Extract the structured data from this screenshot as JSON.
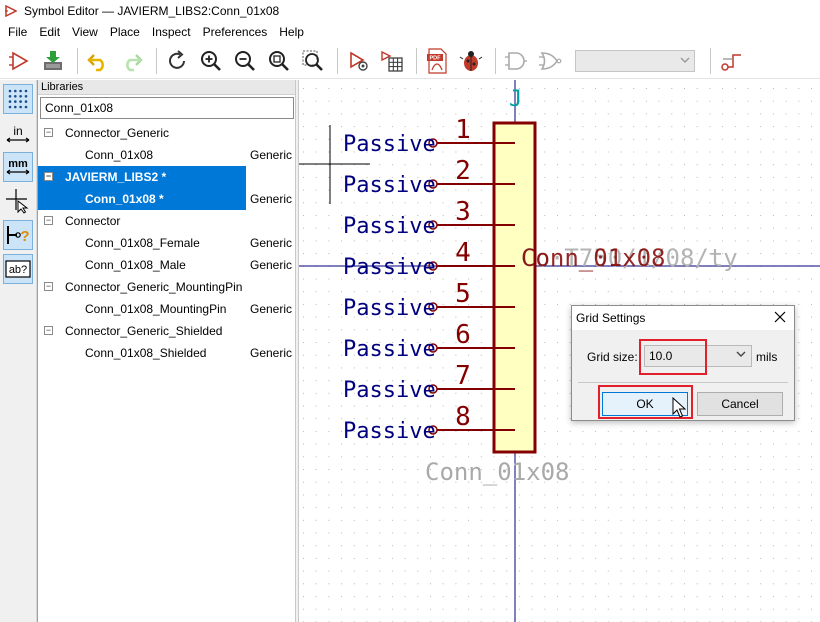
{
  "window": {
    "title": "Symbol Editor — JAVIERM_LIBS2:Conn_01x08"
  },
  "menu": [
    "File",
    "Edit",
    "View",
    "Place",
    "Inspect",
    "Preferences",
    "Help"
  ],
  "toolbar": {
    "icons": [
      "new-symbol-icon",
      "save-icon",
      "undo-icon",
      "redo-icon",
      "refresh-icon",
      "zoom-in-icon",
      "zoom-out-icon",
      "zoom-fit-icon",
      "zoom-selection-icon",
      "symbol-properties-icon",
      "pin-table-icon",
      "export-pdf-icon",
      "check-icon",
      "de-morgan-standard-icon",
      "de-morgan-alternate-icon",
      "unit-select-icon",
      "pin-ref-icon"
    ],
    "unit_combo_value": ""
  },
  "left_tools": [
    "grid-toggle",
    "units-in",
    "units-mm",
    "cursor-fullscreen",
    "pin-electrical-type",
    "text-field"
  ],
  "libraries": {
    "header": "Libraries",
    "search_value": "Conn_01x08",
    "tree": [
      {
        "type": "lib",
        "name": "Connector_Generic",
        "expanded": true
      },
      {
        "type": "sym",
        "name": "Conn_01x08",
        "desc": "Generic"
      },
      {
        "type": "lib",
        "name": "JAVIERM_LIBS2 *",
        "expanded": true,
        "selected": true
      },
      {
        "type": "sym",
        "name": "Conn_01x08 *",
        "desc": "Generic",
        "selected": true
      },
      {
        "type": "lib",
        "name": "Connector",
        "expanded": true
      },
      {
        "type": "sym",
        "name": "Conn_01x08_Female",
        "desc": "Generic"
      },
      {
        "type": "sym",
        "name": "Conn_01x08_Male",
        "desc": "Generic"
      },
      {
        "type": "lib",
        "name": "Connector_Generic_MountingPin",
        "expanded": true
      },
      {
        "type": "sym",
        "name": "Conn_01x08_MountingPin",
        "desc": "Generic"
      },
      {
        "type": "lib",
        "name": "Connector_Generic_Shielded",
        "expanded": true
      },
      {
        "type": "sym",
        "name": "Conn_01x08_Shielded",
        "desc": "Generic"
      }
    ]
  },
  "schematic": {
    "reference": "J",
    "pins": [
      {
        "number": "1",
        "type": "Passive"
      },
      {
        "number": "2",
        "type": "Passive"
      },
      {
        "number": "3",
        "type": "Passive"
      },
      {
        "number": "4",
        "type": "Passive"
      },
      {
        "number": "5",
        "type": "Passive"
      },
      {
        "number": "6",
        "type": "Passive"
      },
      {
        "number": "7",
        "type": "Passive"
      },
      {
        "number": "8",
        "type": "Passive"
      }
    ],
    "value_field": "Conn_01x08",
    "overlap_text": "Conn_01x08",
    "overlap_ghost": "Co·T750/1/08/ty",
    "colors": {
      "pin": "#840000",
      "body_fill": "#ffffc2",
      "body_stroke": "#840000",
      "text_blue": "#00007f",
      "field_gray": "#a9a9a9"
    }
  },
  "dialog": {
    "title": "Grid Settings",
    "grid_size_label": "Grid size:",
    "grid_size_value": "10.0",
    "units": "mils",
    "ok_label": "OK",
    "cancel_label": "Cancel",
    "highlight_color": "#e0202a"
  }
}
